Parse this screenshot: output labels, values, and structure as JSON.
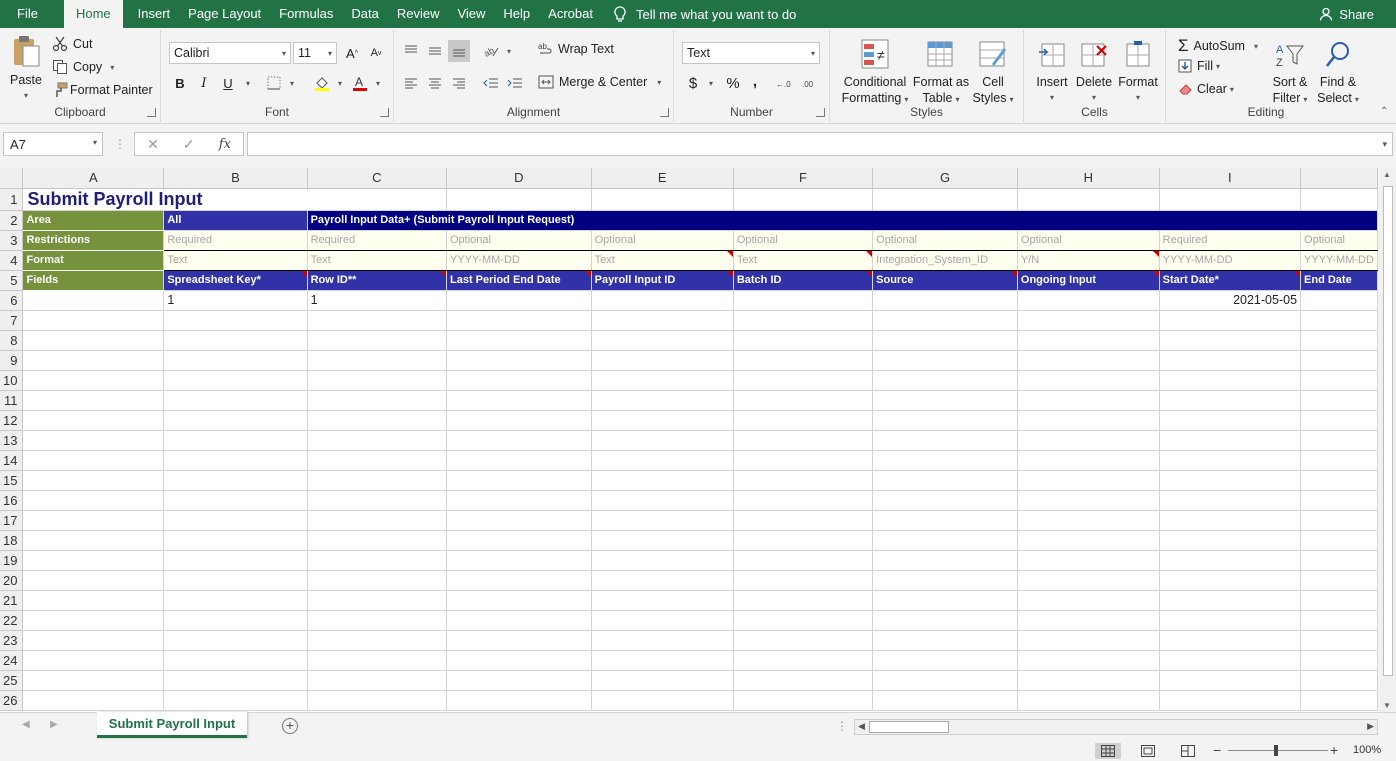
{
  "menu": {
    "tabs": [
      "File",
      "Home",
      "Insert",
      "Page Layout",
      "Formulas",
      "Data",
      "Review",
      "View",
      "Help",
      "Acrobat"
    ],
    "active": "Home",
    "tell_me": "Tell me what you want to do",
    "share": "Share"
  },
  "ribbon": {
    "clipboard": {
      "paste": "Paste",
      "cut": "Cut",
      "copy": "Copy",
      "format_painter": "Format Painter",
      "label": "Clipboard"
    },
    "font": {
      "name": "Calibri",
      "size": "11",
      "bold": "B",
      "italic": "I",
      "underline": "U",
      "label": "Font",
      "font_color": "#e00000",
      "highlight_color": "#ffff00"
    },
    "alignment": {
      "wrap_text": "Wrap Text",
      "merge_center": "Merge & Center",
      "label": "Alignment"
    },
    "number": {
      "format": "Text",
      "currency": "$",
      "percent": "%",
      "comma": ",",
      "label": "Number"
    },
    "styles": {
      "conditional": "Conditional",
      "conditional2": "Formatting",
      "format_table": "Format as",
      "format_table2": "Table",
      "cell_styles": "Cell",
      "cell_styles2": "Styles",
      "label": "Styles"
    },
    "cells": {
      "insert": "Insert",
      "delete": "Delete",
      "format": "Format",
      "label": "Cells"
    },
    "editing": {
      "autosum": "AutoSum",
      "fill": "Fill",
      "clear": "Clear",
      "sort": "Sort &",
      "sort2": "Filter",
      "find": "Find &",
      "find2": "Select",
      "label": "Editing"
    }
  },
  "formula_bar": {
    "name_box": "A7",
    "formula": "",
    "fx": "fx"
  },
  "columns": [
    "A",
    "B",
    "C",
    "D",
    "E",
    "F",
    "G",
    "H",
    "I"
  ],
  "sheet": {
    "title": "Submit Payroll Input",
    "area_label": "Area",
    "area_all": "All",
    "area_data": "Payroll Input Data+ (Submit Payroll Input Request)",
    "restrictions_label": "Restrictions",
    "restrictions": [
      "Required",
      "Required",
      "Optional",
      "Optional",
      "Optional",
      "Optional",
      "Optional",
      "Required",
      "Optional"
    ],
    "format_label": "Format",
    "formats": [
      "Text",
      "Text",
      "YYYY-MM-DD",
      "Text",
      "Text",
      "Integration_System_ID",
      "Y/N",
      "YYYY-MM-DD",
      "YYYY-MM-DD"
    ],
    "fields_label": "Fields",
    "fields": [
      "Spreadsheet Key*",
      "Row ID**",
      "Last Period End Date",
      "Payroll Input ID",
      "Batch ID",
      "Source",
      "Ongoing Input",
      "Start Date*",
      "End Date"
    ],
    "row6": [
      "1",
      "1",
      "",
      "",
      "",
      "",
      "",
      "2021-05-05",
      ""
    ]
  },
  "sheet_tab": "Submit Payroll Input",
  "status": {
    "zoom": "100%"
  }
}
